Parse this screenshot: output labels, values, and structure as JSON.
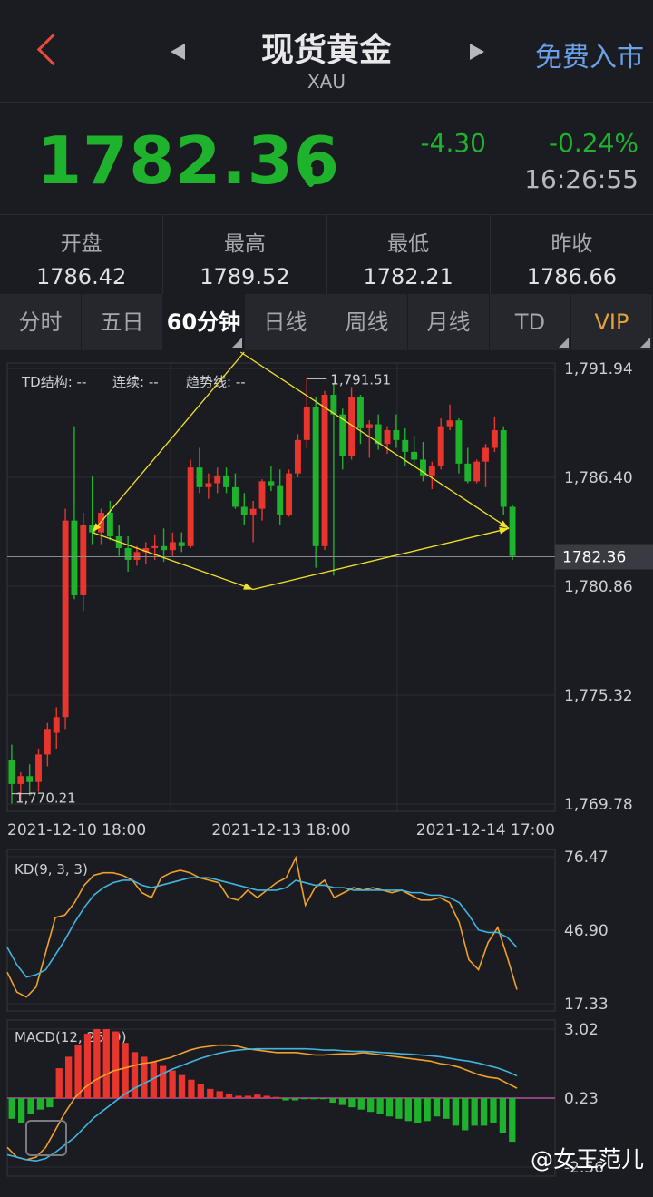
{
  "header": {
    "title": "现货黄金",
    "subtitle": "XAU",
    "free_entry": "免费入市"
  },
  "quote": {
    "price": "1782.36",
    "change": "-4.30",
    "change_pct": "-0.24%",
    "time": "16:26:55",
    "down_color": "#1fb22c",
    "up_color": "#e8352e"
  },
  "stats": [
    {
      "label": "开盘",
      "value": "1786.42"
    },
    {
      "label": "最高",
      "value": "1789.52"
    },
    {
      "label": "最低",
      "value": "1782.21"
    },
    {
      "label": "昨收",
      "value": "1786.66"
    }
  ],
  "tabs": [
    {
      "label": "分时",
      "active": false
    },
    {
      "label": "五日",
      "active": false
    },
    {
      "label": "60分钟",
      "active": true
    },
    {
      "label": "日线",
      "active": false
    },
    {
      "label": "周线",
      "active": false
    },
    {
      "label": "月线",
      "active": false
    },
    {
      "label": "TD",
      "active": false
    },
    {
      "label": "VIP",
      "active": false
    }
  ],
  "watermark": "@女王范儿",
  "chart_data": [
    {
      "type": "candlestick",
      "indicator_labels": {
        "td": "TD结构: --",
        "cont": "连续: --",
        "trend": "趋势线: --"
      },
      "y_ticks": [
        "1,791.94",
        "1,786.40",
        "1,780.86",
        "1,775.32",
        "1,769.78"
      ],
      "x_ticks": [
        "2021-12-10 18:00",
        "2021-12-13 18:00",
        "2021-12-14 17:00"
      ],
      "ylim": [
        1769.78,
        1791.94
      ],
      "current_price": "1782.36",
      "high_label": "1,791.51",
      "low_label": "1,770.21",
      "candles": [
        [
          1772.0,
          1772.8,
          1769.8,
          1770.8
        ],
        [
          1770.8,
          1771.4,
          1769.9,
          1771.2
        ],
        [
          1771.2,
          1771.8,
          1770.2,
          1770.9
        ],
        [
          1770.9,
          1772.6,
          1770.4,
          1772.3
        ],
        [
          1772.3,
          1773.9,
          1771.7,
          1773.6
        ],
        [
          1773.4,
          1774.7,
          1772.6,
          1774.2
        ],
        [
          1774.2,
          1784.8,
          1773.6,
          1784.2
        ],
        [
          1784.2,
          1789.0,
          1780.2,
          1780.4
        ],
        [
          1780.4,
          1784.6,
          1779.6,
          1784.0
        ],
        [
          1784.0,
          1786.5,
          1783.0,
          1783.6
        ],
        [
          1783.6,
          1784.8,
          1783.0,
          1784.6
        ],
        [
          1784.6,
          1785.2,
          1783.2,
          1783.4
        ],
        [
          1783.4,
          1784.0,
          1782.4,
          1782.8
        ],
        [
          1782.8,
          1783.4,
          1781.6,
          1782.2
        ],
        [
          1782.2,
          1782.9,
          1781.9,
          1782.6
        ],
        [
          1782.6,
          1783.1,
          1782.0,
          1782.8
        ],
        [
          1782.8,
          1783.5,
          1782.2,
          1782.9
        ],
        [
          1782.9,
          1783.8,
          1782.1,
          1782.7
        ],
        [
          1782.7,
          1783.6,
          1782.4,
          1783.1
        ],
        [
          1783.1,
          1783.6,
          1782.6,
          1782.9
        ],
        [
          1782.9,
          1787.3,
          1782.8,
          1786.9
        ],
        [
          1786.9,
          1787.9,
          1785.6,
          1785.9
        ],
        [
          1785.9,
          1786.6,
          1785.3,
          1786.1
        ],
        [
          1786.1,
          1786.9,
          1785.6,
          1786.5
        ],
        [
          1786.5,
          1786.9,
          1785.6,
          1785.9
        ],
        [
          1785.9,
          1786.6,
          1784.8,
          1784.9
        ],
        [
          1784.9,
          1785.6,
          1784.0,
          1784.5
        ],
        [
          1784.5,
          1785.2,
          1783.1,
          1784.8
        ],
        [
          1784.8,
          1786.3,
          1784.2,
          1786.2
        ],
        [
          1786.2,
          1787.0,
          1785.7,
          1786.0
        ],
        [
          1786.0,
          1786.8,
          1784.0,
          1784.5
        ],
        [
          1784.5,
          1786.8,
          1784.4,
          1786.6
        ],
        [
          1786.6,
          1788.6,
          1786.4,
          1788.3
        ],
        [
          1788.3,
          1791.5,
          1787.9,
          1790.0
        ],
        [
          1790.0,
          1790.5,
          1781.8,
          1782.9
        ],
        [
          1782.9,
          1790.8,
          1782.7,
          1790.6
        ],
        [
          1790.6,
          1791.2,
          1781.4,
          1789.6
        ],
        [
          1789.6,
          1789.9,
          1786.8,
          1787.5
        ],
        [
          1787.5,
          1791.0,
          1787.3,
          1790.5
        ],
        [
          1790.5,
          1790.6,
          1788.1,
          1788.9
        ],
        [
          1788.9,
          1789.3,
          1787.4,
          1789.1
        ],
        [
          1789.1,
          1789.6,
          1787.8,
          1788.1
        ],
        [
          1788.1,
          1789.0,
          1787.6,
          1788.8
        ],
        [
          1788.8,
          1789.6,
          1787.9,
          1788.3
        ],
        [
          1788.3,
          1788.9,
          1787.0,
          1787.7
        ],
        [
          1787.7,
          1788.5,
          1786.9,
          1787.3
        ],
        [
          1787.3,
          1788.2,
          1786.2,
          1786.5
        ],
        [
          1786.5,
          1787.2,
          1785.8,
          1787.0
        ],
        [
          1787.0,
          1789.4,
          1786.8,
          1789.0
        ],
        [
          1789.0,
          1790.1,
          1788.8,
          1789.3
        ],
        [
          1789.3,
          1789.4,
          1786.6,
          1787.1
        ],
        [
          1787.1,
          1787.9,
          1786.1,
          1786.2
        ],
        [
          1786.2,
          1787.3,
          1786.1,
          1787.2
        ],
        [
          1787.2,
          1788.1,
          1785.9,
          1787.9
        ],
        [
          1787.9,
          1789.5,
          1787.7,
          1788.8
        ],
        [
          1788.8,
          1789.0,
          1784.5,
          1784.9
        ],
        [
          1784.9,
          1785.0,
          1782.2,
          1782.4
        ]
      ]
    },
    {
      "type": "line",
      "title": "KD(9, 3, 3)",
      "y_ticks": [
        "76.47",
        "46.90",
        "17.33"
      ],
      "ylim": [
        17.33,
        76.47
      ],
      "series": [
        {
          "name": "K",
          "color": "#f0a12a",
          "values": [
            30,
            22,
            20,
            24,
            38,
            52,
            53,
            58,
            65,
            69,
            70,
            70,
            69,
            67,
            62,
            60,
            68,
            70,
            71,
            70,
            68,
            67,
            66,
            60,
            59,
            63,
            60,
            63,
            66,
            68,
            76,
            57,
            64,
            67,
            60,
            62,
            64,
            63,
            64,
            63,
            62,
            63,
            61,
            59,
            59,
            60,
            58,
            50,
            35,
            31,
            42,
            48,
            36,
            23
          ]
        },
        {
          "name": "D",
          "color": "#3fb6e0",
          "values": [
            40,
            33,
            28,
            29,
            31,
            37,
            43,
            50,
            56,
            61,
            64,
            66,
            67,
            67,
            65,
            64,
            65,
            66,
            67,
            68,
            68,
            68,
            67,
            66,
            65,
            64,
            63,
            63,
            63,
            64,
            67,
            66,
            65,
            65,
            64,
            64,
            63,
            63,
            63,
            63,
            63,
            63,
            62,
            62,
            61,
            61,
            60,
            58,
            53,
            47,
            46,
            46,
            44,
            40
          ]
        }
      ]
    },
    {
      "type": "bar",
      "title": "MACD(12, 26, 9)",
      "y_ticks": [
        "3.02",
        "0.23",
        "-2.56"
      ],
      "ylim": [
        -2.56,
        3.02
      ],
      "histogram": [
        -0.9,
        -1.1,
        -0.7,
        -0.5,
        -0.4,
        1.3,
        1.8,
        2.3,
        2.8,
        3.0,
        3.0,
        2.9,
        2.4,
        2.0,
        1.8,
        1.6,
        1.4,
        1.2,
        1.0,
        0.8,
        0.6,
        0.4,
        0.3,
        0.2,
        0.1,
        0.1,
        0.15,
        0.1,
        0.05,
        -0.1,
        -0.1,
        -0.05,
        -0.05,
        -0.05,
        -0.2,
        -0.3,
        -0.4,
        -0.5,
        -0.6,
        -0.7,
        -0.8,
        -0.9,
        -1.0,
        -1.1,
        -1.0,
        -0.8,
        -0.9,
        -1.2,
        -1.4,
        -1.2,
        -1.2,
        -1.1,
        -1.5,
        -1.9
      ],
      "series": [
        {
          "name": "DIF",
          "color": "#f0a12a",
          "values": [
            -2.0,
            -2.4,
            -2.5,
            -2.4,
            -2.0,
            -1.3,
            -0.6,
            0.0,
            0.4,
            0.7,
            0.9,
            1.1,
            1.2,
            1.3,
            1.4,
            1.45,
            1.55,
            1.65,
            1.8,
            1.95,
            2.05,
            2.1,
            2.15,
            2.15,
            2.1,
            2.0,
            1.95,
            1.9,
            1.85,
            1.85,
            1.85,
            1.8,
            1.75,
            1.75,
            1.78,
            1.8,
            1.8,
            1.85,
            1.8,
            1.75,
            1.7,
            1.65,
            1.6,
            1.55,
            1.5,
            1.4,
            1.35,
            1.25,
            1.1,
            0.95,
            0.85,
            0.8,
            0.6,
            0.4
          ]
        },
        {
          "name": "DEA",
          "color": "#3fb6e0",
          "values": [
            -2.3,
            -2.4,
            -2.5,
            -2.55,
            -2.45,
            -2.2,
            -1.9,
            -1.6,
            -1.2,
            -0.8,
            -0.5,
            -0.2,
            0.1,
            0.35,
            0.55,
            0.75,
            0.95,
            1.15,
            1.3,
            1.45,
            1.6,
            1.72,
            1.82,
            1.9,
            1.95,
            1.98,
            2.0,
            2.0,
            2.0,
            2.0,
            2.0,
            2.0,
            1.98,
            1.95,
            1.95,
            1.92,
            1.9,
            1.9,
            1.88,
            1.85,
            1.83,
            1.8,
            1.78,
            1.75,
            1.72,
            1.68,
            1.62,
            1.55,
            1.5,
            1.42,
            1.32,
            1.22,
            1.08,
            0.9
          ]
        }
      ]
    }
  ]
}
